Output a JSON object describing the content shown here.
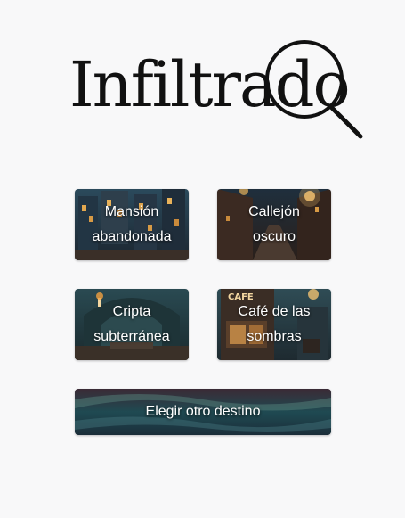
{
  "app": {
    "logo_text": "Infiltrado",
    "logo_icon": "magnifying-glass-icon"
  },
  "destinations": [
    {
      "id": "mansion",
      "line1": "Mansión",
      "line2": "abandonada"
    },
    {
      "id": "alley",
      "line1": "Callejón",
      "line2": "oscuro"
    },
    {
      "id": "crypt",
      "line1": "Cripta",
      "line2": "subterránea"
    },
    {
      "id": "cafe",
      "line1": "Café de las",
      "line2": "sombras",
      "sign_text": "CAFE"
    }
  ],
  "other_button": {
    "label": "Elegir otro destino"
  },
  "colors": {
    "background": "#f8f8f9",
    "tile_dark": "#1e2b3a",
    "tile_teal": "#2d5a5e",
    "lamp_glow": "#e8b25a"
  }
}
